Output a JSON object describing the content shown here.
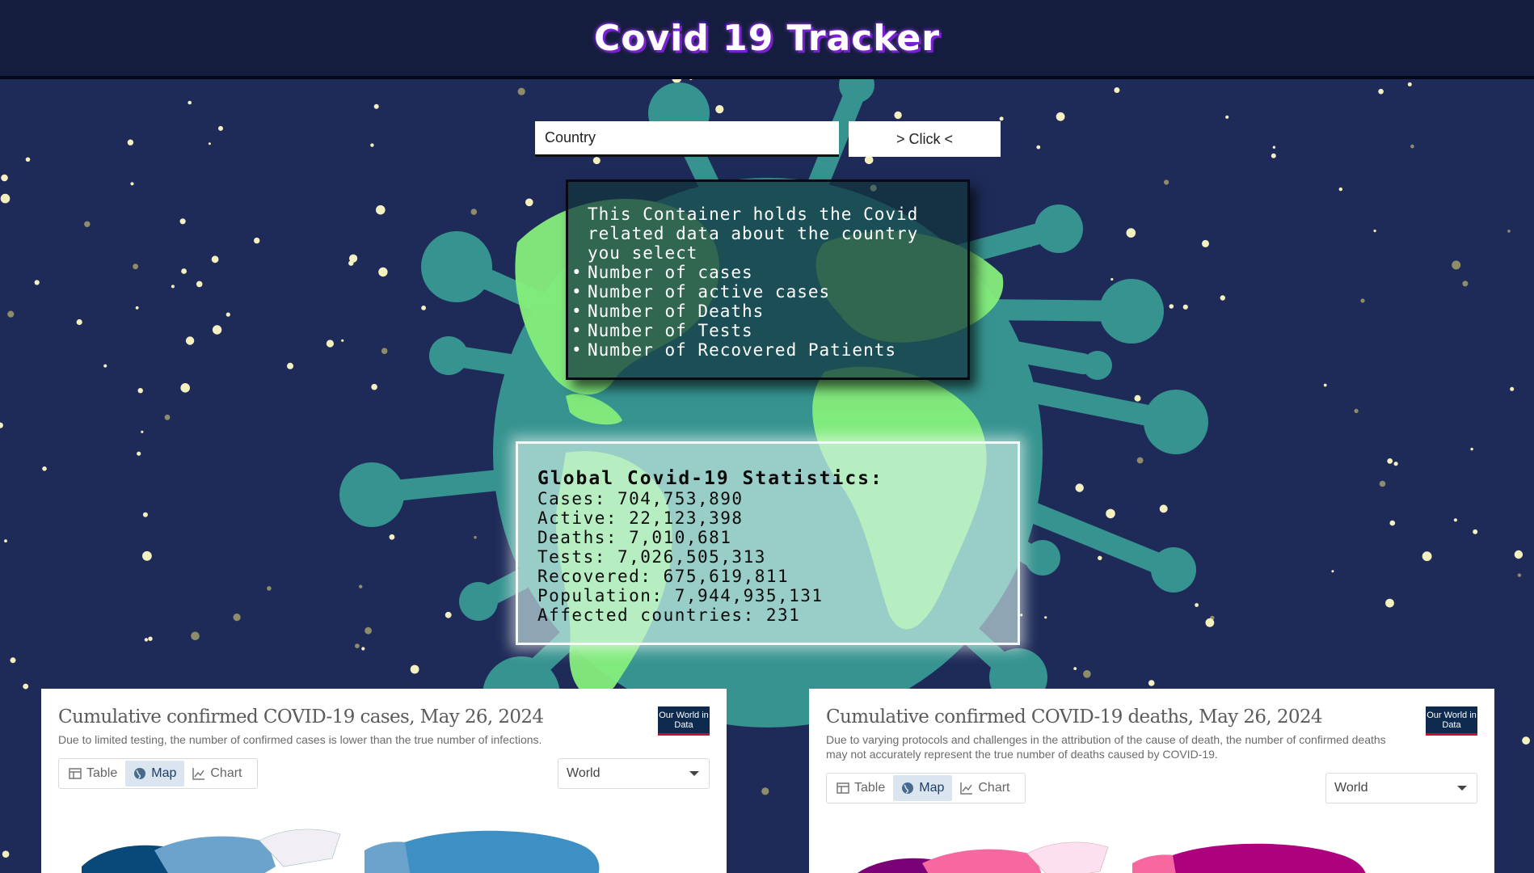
{
  "header": {
    "title": "Covid 19 Tracker"
  },
  "search": {
    "placeholder": "Country",
    "button_label": "> Click <"
  },
  "info_box": {
    "intro": "This Container holds the Covid related data about the country you select",
    "items": [
      "Number of cases",
      "Number of active cases",
      "Number of Deaths",
      "Number of Tests",
      "Number of Recovered Patients"
    ]
  },
  "global_stats": {
    "title": "Global Covid-19 Statistics:",
    "lines": [
      "Cases: 704,753,890",
      "Active: 22,123,398",
      "Deaths: 7,010,681",
      "Tests: 7,026,505,313",
      "Recovered: 675,619,811",
      "Population: 7,944,935,131",
      "Affected countries: 231"
    ]
  },
  "panels": [
    {
      "title": "Cumulative confirmed COVID-19 cases, May 26, 2024",
      "subtitle": "Due to limited testing, the number of confirmed cases is lower than the true number of infections.",
      "logo": "Our World in Data",
      "tabs": [
        "Table",
        "Map",
        "Chart"
      ],
      "active_tab": "Map",
      "region": "World",
      "map_colors": [
        "#08497a",
        "#6ba3cc",
        "#f1eef4",
        "#3e8fc4"
      ]
    },
    {
      "title": "Cumulative confirmed COVID-19 deaths, May 26, 2024",
      "subtitle": "Due to varying protocols and challenges in the attribution of the cause of death, the number of confirmed deaths may not accurately represent the true number of deaths caused by COVID-19.",
      "logo": "Our World in Data",
      "tabs": [
        "Table",
        "Map",
        "Chart"
      ],
      "active_tab": "Map",
      "region": "World",
      "map_colors": [
        "#7a0177",
        "#f768a1",
        "#fde0ef",
        "#ae017e"
      ]
    }
  ],
  "colors": {
    "background": "#1e2b58",
    "virus_teal": "#36938f",
    "virus_green": "#86ee7c",
    "star": "#f5f0c0"
  }
}
